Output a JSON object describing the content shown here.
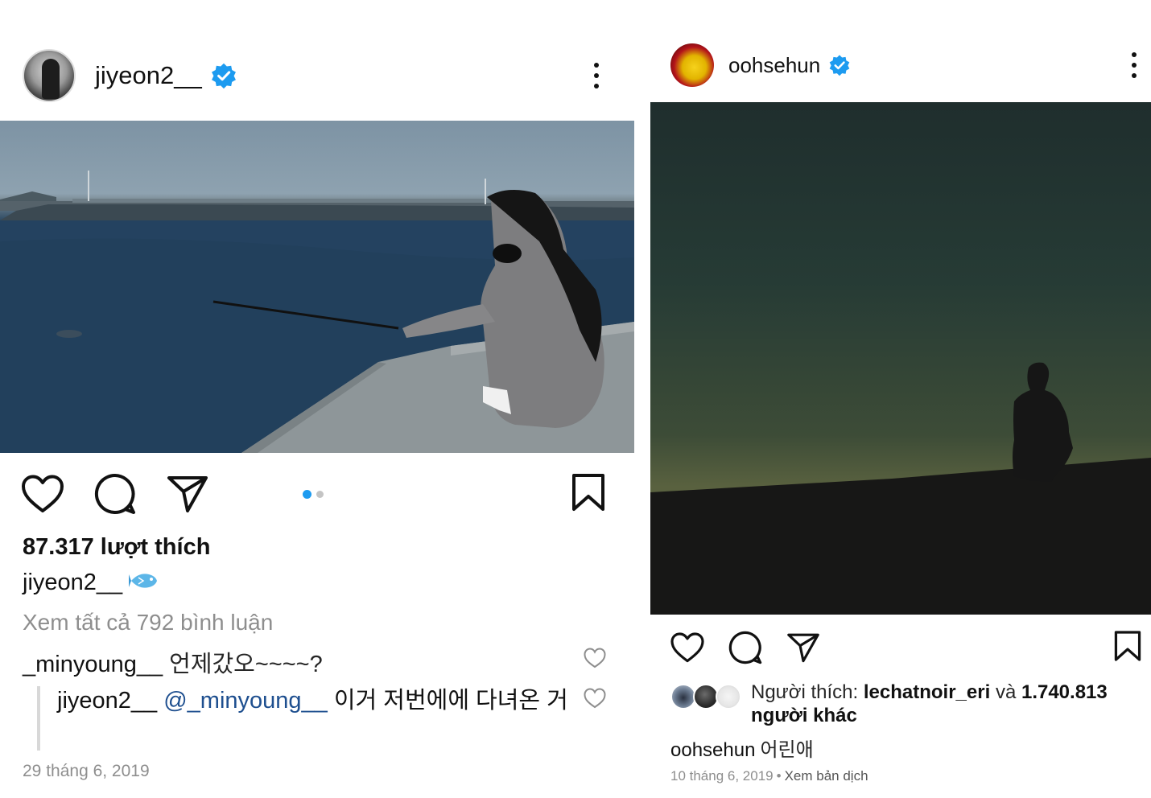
{
  "left_post": {
    "username": "jiyeon2__",
    "likes": "87.317 lượt thích",
    "caption_user": "jiyeon2__",
    "caption_emoji": "fish-emoji",
    "view_all_comments": "Xem tất cả 792 bình luận",
    "comments": [
      {
        "user": "_minyoung__",
        "text": "언제갔오~~~~?"
      },
      {
        "user": "jiyeon2__",
        "mention": "@_minyoung__",
        "text": "이거 저번에에 다녀온 거"
      }
    ],
    "date": "29 tháng 6, 2019",
    "carousel": {
      "count": 2,
      "active": 1
    }
  },
  "right_post": {
    "username": "oohsehun",
    "liked_prefix": "Người thích:",
    "liked_user": "lechatnoir_eri",
    "liked_and": "và",
    "liked_others": "1.740.813 người khác",
    "caption_user": "oohsehun",
    "caption_text": "어린애",
    "date": "10 tháng 6, 2019",
    "separator": "•",
    "translate": "Xem bản dịch"
  },
  "colors": {
    "verified": "#1d9bf0",
    "text": "#262626",
    "muted": "#8e8e8e",
    "mention": "#1e4f8f",
    "carousel_active": "#1d9bf0"
  },
  "icons": [
    "verified-badge-icon",
    "more-options-icon",
    "heart-icon",
    "comment-icon",
    "share-icon",
    "bookmark-icon",
    "small-heart-icon"
  ]
}
